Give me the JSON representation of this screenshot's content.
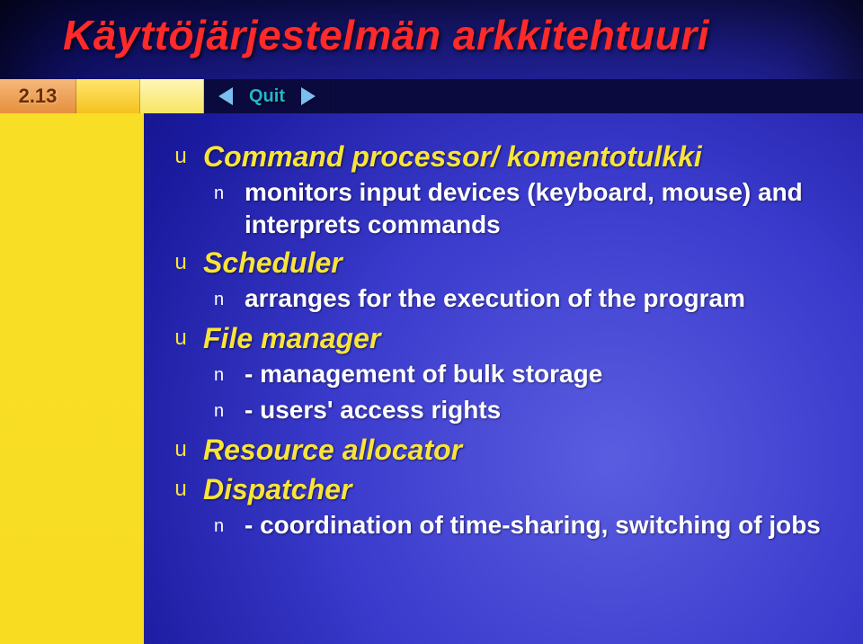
{
  "slide": {
    "title": "Käyttöjärjestelmän arkkitehtuuri",
    "page_number": "2.13",
    "quit_label": "Quit"
  },
  "bullets": [
    {
      "label": "Command processor/ komentotulkki",
      "sub": [
        {
          "label": "monitors input devices (keyboard, mouse) and interprets commands"
        }
      ]
    },
    {
      "label": "Scheduler",
      "sub": [
        {
          "label": "arranges for the execution of the program"
        }
      ]
    },
    {
      "label": "File manager",
      "sub": [
        {
          "label": "- management of bulk storage"
        },
        {
          "label": "- users' access rights"
        }
      ]
    },
    {
      "label": "Resource allocator",
      "sub": []
    },
    {
      "label": "Dispatcher",
      "sub": [
        {
          "label": "- coordination of time-sharing, switching of jobs"
        }
      ]
    }
  ]
}
